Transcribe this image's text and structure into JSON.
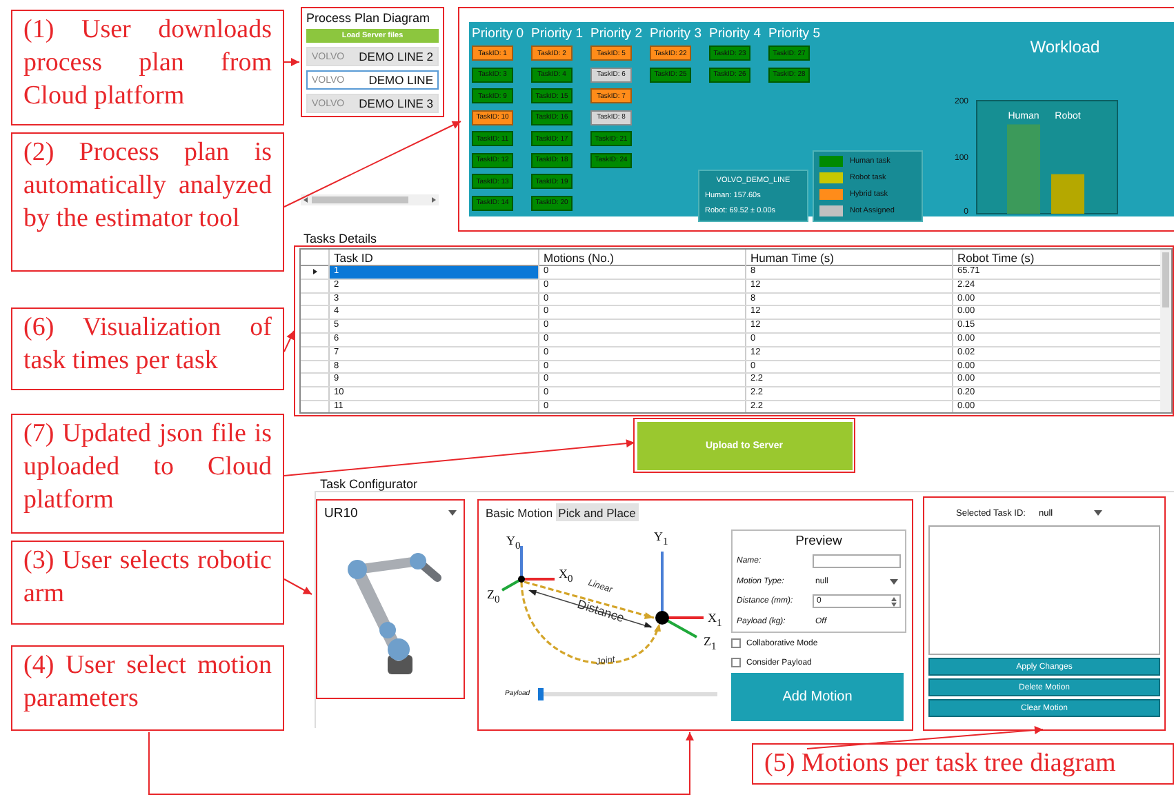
{
  "callouts": [
    {
      "text": "(1) User downloads process plan from Cloud platform"
    },
    {
      "text": "(2) Process plan is automatically analyzed by the estimator tool"
    },
    {
      "text": "(6) Visualization of task times per task"
    },
    {
      "text": "(7) Updated json file is uploaded to Cloud platform"
    },
    {
      "text": "(3) User selects robotic arm"
    },
    {
      "text": "(4) User select motion parameters"
    }
  ],
  "process_plan": {
    "title": "Process Plan Diagram",
    "load_button": "Load Server files",
    "lines": [
      {
        "prefix": "VOLVO",
        "label": "DEMO LINE 2",
        "selected": false
      },
      {
        "prefix": "VOLVO",
        "label": "DEMO LINE",
        "selected": true
      },
      {
        "prefix": "VOLVO",
        "label": "DEMO LINE 3",
        "selected": false
      }
    ]
  },
  "priority_board": {
    "columns": [
      {
        "header": "Priority 0",
        "tasks": [
          {
            "label": "TaskID: 1",
            "kind": "hybrid"
          },
          {
            "label": "TaskID: 3",
            "kind": "human"
          },
          {
            "label": "TaskID: 9",
            "kind": "human"
          },
          {
            "label": "TaskID: 10",
            "kind": "hybrid"
          },
          {
            "label": "TaskID: 11",
            "kind": "human"
          },
          {
            "label": "TaskID: 12",
            "kind": "human"
          },
          {
            "label": "TaskID: 13",
            "kind": "human"
          },
          {
            "label": "TaskID: 14",
            "kind": "human"
          }
        ]
      },
      {
        "header": "Priority 1",
        "tasks": [
          {
            "label": "TaskID: 2",
            "kind": "hybrid"
          },
          {
            "label": "TaskID: 4",
            "kind": "human"
          },
          {
            "label": "TaskID: 15",
            "kind": "human"
          },
          {
            "label": "TaskID: 16",
            "kind": "human"
          },
          {
            "label": "TaskID: 17",
            "kind": "human"
          },
          {
            "label": "TaskID: 18",
            "kind": "human"
          },
          {
            "label": "TaskID: 19",
            "kind": "human"
          },
          {
            "label": "TaskID: 20",
            "kind": "human"
          }
        ]
      },
      {
        "header": "Priority 2",
        "tasks": [
          {
            "label": "TaskID: 5",
            "kind": "hybrid"
          },
          {
            "label": "TaskID: 6",
            "kind": "unassigned"
          },
          {
            "label": "TaskID: 7",
            "kind": "hybrid"
          },
          {
            "label": "TaskID: 8",
            "kind": "unassigned"
          },
          {
            "label": "TaskID: 21",
            "kind": "human"
          },
          {
            "label": "TaskID: 24",
            "kind": "human"
          }
        ]
      },
      {
        "header": "Priority 3",
        "tasks": [
          {
            "label": "TaskID: 22",
            "kind": "hybrid"
          },
          {
            "label": "TaskID: 25",
            "kind": "human"
          }
        ]
      },
      {
        "header": "Priority 4",
        "tasks": [
          {
            "label": "TaskID: 23",
            "kind": "human"
          },
          {
            "label": "TaskID: 26",
            "kind": "human"
          }
        ]
      },
      {
        "header": "Priority 5",
        "tasks": [
          {
            "label": "TaskID: 27",
            "kind": "human"
          },
          {
            "label": "TaskID: 28",
            "kind": "human"
          }
        ]
      }
    ],
    "info": {
      "line": "VOLVO_DEMO_LINE",
      "human": "Human: 157.60s",
      "robot": "Robot: 69.52 ± 0.00s"
    },
    "legend": [
      {
        "label": "Human task",
        "color": "#008a00"
      },
      {
        "label": "Robot task",
        "color": "#c8c800"
      },
      {
        "label": "Hybrid task",
        "color": "#ff8c1a"
      },
      {
        "label": "Not Assigned",
        "color": "#c0c0c0"
      }
    ],
    "chart_data": {
      "type": "bar",
      "title": "Workload",
      "categories": [
        "Human",
        "Robot"
      ],
      "values": [
        158,
        70
      ],
      "ylim": [
        0,
        200
      ],
      "yticks": [
        0,
        100,
        200
      ]
    }
  },
  "tasks": {
    "title": "Tasks Details",
    "columns": [
      "Task ID",
      "Motions (No.)",
      "Human Time (s)",
      "Robot Time (s)"
    ],
    "rows": [
      {
        "cells": [
          "1",
          "0",
          "8",
          "65.71"
        ],
        "selected": true
      },
      {
        "cells": [
          "2",
          "0",
          "12",
          "2.24"
        ],
        "selected": false
      },
      {
        "cells": [
          "3",
          "0",
          "8",
          "0.00"
        ],
        "selected": false
      },
      {
        "cells": [
          "4",
          "0",
          "12",
          "0.00"
        ],
        "selected": false
      },
      {
        "cells": [
          "5",
          "0",
          "12",
          "0.15"
        ],
        "selected": false
      },
      {
        "cells": [
          "6",
          "0",
          "0",
          "0.00"
        ],
        "selected": false
      },
      {
        "cells": [
          "7",
          "0",
          "12",
          "0.02"
        ],
        "selected": false
      },
      {
        "cells": [
          "8",
          "0",
          "0",
          "0.00"
        ],
        "selected": false
      },
      {
        "cells": [
          "9",
          "0",
          "2.2",
          "0.00"
        ],
        "selected": false
      },
      {
        "cells": [
          "10",
          "0",
          "2.2",
          "0.20"
        ],
        "selected": false
      },
      {
        "cells": [
          "11",
          "0",
          "2.2",
          "0.00"
        ],
        "selected": false
      }
    ]
  },
  "upload_button": "Upload to Server",
  "configurator": {
    "title": "Task Configurator",
    "robot": "UR10",
    "motion": {
      "tabs": [
        {
          "label": "Basic Motion",
          "selected": true
        },
        {
          "label": "Pick and Place",
          "selected": false
        }
      ],
      "axis_labels": [
        "Y$_{0}$",
        "X$_{0}$",
        "Z$_{0}$",
        "Y$_{1}$",
        "X$_{1}$",
        "Z$_{1}$"
      ],
      "path_labels": [
        "Linear",
        "Distance",
        "Joint"
      ],
      "payload_slider": {
        "label": "Payload",
        "level": 0
      },
      "preview": {
        "title": "Preview",
        "fields": [
          {
            "label": "Name:",
            "kind": "text"
          },
          {
            "label": "Motion Type:",
            "kind": "dropdown",
            "value": "null"
          },
          {
            "label": "Distance (mm):",
            "kind": "spinner",
            "value": "0"
          },
          {
            "label": "Payload (kg):",
            "kind": "static",
            "value": "Off"
          }
        ]
      },
      "checkboxes": [
        {
          "label": "Collaborative Mode",
          "checked": false
        },
        {
          "label": "Consider Payload",
          "checked": false
        }
      ],
      "add_button": "Add Motion"
    },
    "motions": {
      "label": "Selected Task ID:",
      "value": "null",
      "buttons": [
        "Apply Changes",
        "Delete Motion",
        "Clear Motion"
      ]
    }
  },
  "bottom_callout": "(5) Motions per task tree diagram"
}
